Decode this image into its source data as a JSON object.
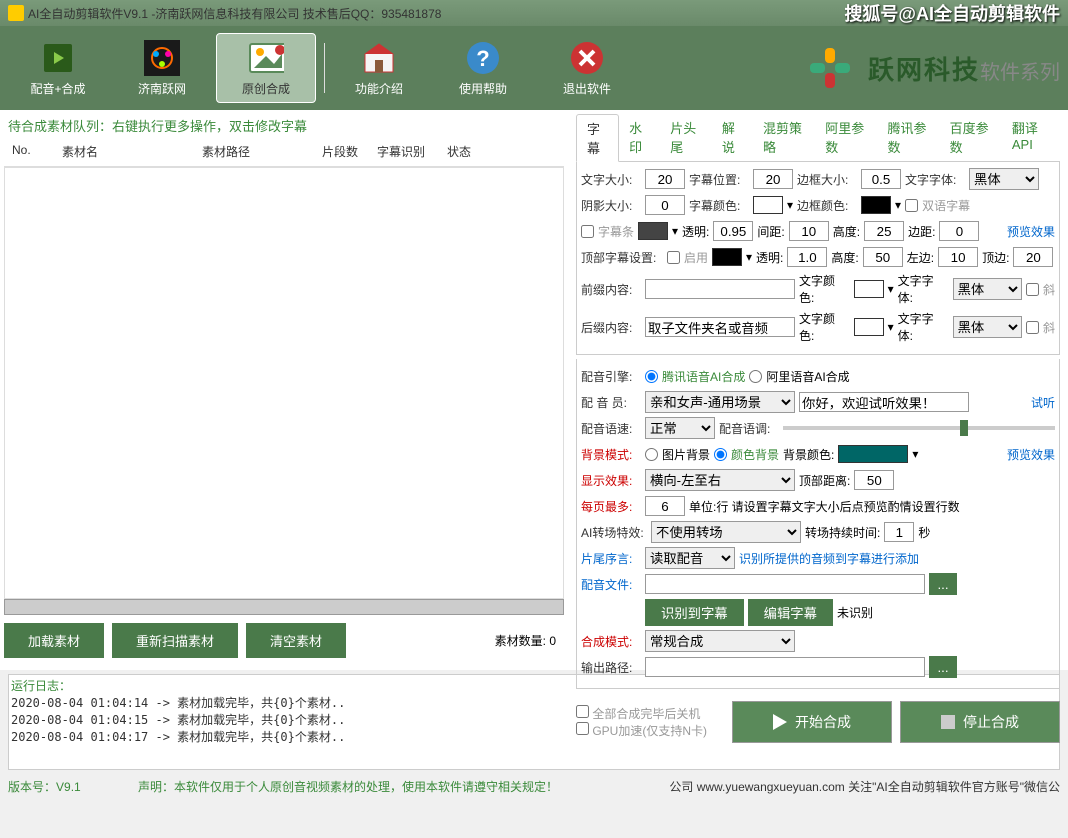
{
  "title": {
    "left": "AI全自动剪辑软件V9.1 -济南跃网信息科技有限公司 技术售后QQ：935481878",
    "right": "搜狐号@AI全自动剪辑软件"
  },
  "toolbar": [
    {
      "label": "配音+合成",
      "id": "dub-compose"
    },
    {
      "label": "济南跃网",
      "id": "company"
    },
    {
      "label": "原创合成",
      "id": "original",
      "active": true
    },
    {
      "label": "功能介绍",
      "id": "features"
    },
    {
      "label": "使用帮助",
      "id": "help"
    },
    {
      "label": "退出软件",
      "id": "exit"
    }
  ],
  "brand": {
    "name": "跃网科技",
    "sub": "软件系列"
  },
  "queue_hint": "待合成素材队列：右键执行更多操作，双击修改字幕",
  "columns": [
    "No.",
    "素材名",
    "素材路径",
    "片段数",
    "字幕识别",
    "状态"
  ],
  "left_buttons": {
    "load": "加载素材",
    "rescan": "重新扫描素材",
    "clear": "清空素材"
  },
  "mat_count": {
    "label": "素材数量:",
    "value": "0"
  },
  "tabs": [
    "字幕",
    "水印",
    "片头尾",
    "解说",
    "混剪策略",
    "阿里参数",
    "腾讯参数",
    "百度参数",
    "翻译API"
  ],
  "sub": {
    "font_size_label": "文字大小:",
    "font_size": "20",
    "pos_label": "字幕位置:",
    "pos": "20",
    "border_label": "边框大小:",
    "border": "0.5",
    "font_label": "文字字体:",
    "font": "黑体",
    "shadow_label": "阴影大小:",
    "shadow": "0",
    "sub_color_label": "字幕颜色:",
    "border_color_label": "边框颜色:",
    "bilingual": "双语字幕",
    "sub_bar_label": "字幕条",
    "trans_label": "透明:",
    "trans": "0.95",
    "gap_label": "间距:",
    "gap": "10",
    "height_label": "高度:",
    "height": "25",
    "margin_label": "边距:",
    "margin": "0",
    "preview": "预览效果",
    "top_label": "顶部字幕设置:",
    "enable": "启用",
    "top_trans": "1.0",
    "top_height": "50",
    "top_left_label": "左边:",
    "top_left": "10",
    "top_top_label": "顶边:",
    "top_top": "20",
    "prefix_label": "前缀内容:",
    "prefix": "",
    "text_color_label": "文字颜色:",
    "italic": "斜",
    "suffix_label": "后缀内容:",
    "suffix": "取子文件夹名或音频"
  },
  "voice": {
    "engine_label": "配音引擎:",
    "opt1": "腾讯语音AI合成",
    "opt2": "阿里语音AI合成",
    "member_label": "配 音 员:",
    "member": "亲和女声-通用场景",
    "greeting": "你好，欢迎试听效果！",
    "test": "试听",
    "speed_label": "配音语速:",
    "speed": "正常",
    "tone_label": "配音语调:",
    "bg_mode_label": "背景模式:",
    "bg_img": "图片背景",
    "bg_color": "颜色背景",
    "bg_color_label": "背景颜色:",
    "disp_label": "显示效果:",
    "disp": "横向-左至右",
    "top_dist_label": "顶部距离:",
    "top_dist": "50",
    "maxline_label": "每页最多:",
    "maxline": "6",
    "maxline_hint": "单位:行 请设置字幕文字大小后点预览酌情设置行数",
    "trans_label": "AI转场特效:",
    "trans": "不使用转场",
    "trans_dur_label": "转场持续时间:",
    "trans_dur": "1",
    "trans_unit": "秒",
    "tail_label": "片尾序言:",
    "tail": "读取配音",
    "tail_hint": "识别所提供的音频到字幕进行添加",
    "dub_file_label": "配音文件:",
    "recog": "识别到字幕",
    "edit": "编辑字幕",
    "unrecog": "未识别",
    "mode_label": "合成模式:",
    "mode": "常规合成",
    "out_label": "输出路径:"
  },
  "action": {
    "shutdown": "全部合成完毕后关机",
    "gpu": "GPU加速(仅支持N卡)",
    "start": "开始合成",
    "stop": "停止合成"
  },
  "log": {
    "title": "运行日志：",
    "lines": [
      "2020-08-04 01:04:14 -> 素材加载完毕，共{0}个素材..",
      "2020-08-04 01:04:15 -> 素材加载完毕，共{0}个素材..",
      "2020-08-04 01:04:17 -> 素材加载完毕，共{0}个素材.."
    ]
  },
  "status": {
    "version_label": "版本号：",
    "version": "V9.1",
    "disclaimer_label": "声明：",
    "disclaimer": "本软件仅用于个人原创音视频素材的处理，使用本软件请遵守相关规定！",
    "company": "公司 www.yuewangxueyuan.com 关注\"AI全自动剪辑软件官方账号\"微信公"
  }
}
